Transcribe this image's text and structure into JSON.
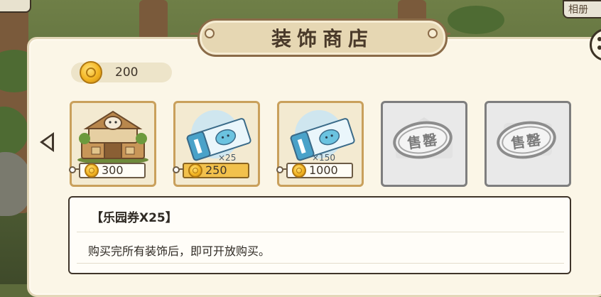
{
  "top_right_button": {
    "label": "相册"
  },
  "title": "装饰商店",
  "coin_balance": "200",
  "items": [
    {
      "name": "park-building",
      "price": "300",
      "quantity": "",
      "sold_out": false,
      "selected": false
    },
    {
      "name": "park-ticket",
      "price": "250",
      "quantity": "×25",
      "sold_out": false,
      "selected": true
    },
    {
      "name": "park-ticket",
      "price": "1000",
      "quantity": "×150",
      "sold_out": false,
      "selected": false
    },
    {
      "name": "sold-out-item",
      "price": "",
      "quantity": "",
      "sold_out": true,
      "stamp": "售罄"
    },
    {
      "name": "sold-out-item",
      "price": "",
      "quantity": "",
      "sold_out": true,
      "stamp": "售罄"
    }
  ],
  "description": {
    "title": "【乐园券X25】",
    "text": "购买完所有装饰后，即可开放购买。"
  },
  "colors": {
    "selected_tag": "#f2c14c",
    "card_border": "#c9a05c",
    "soldout_border": "#7e7e7e"
  }
}
